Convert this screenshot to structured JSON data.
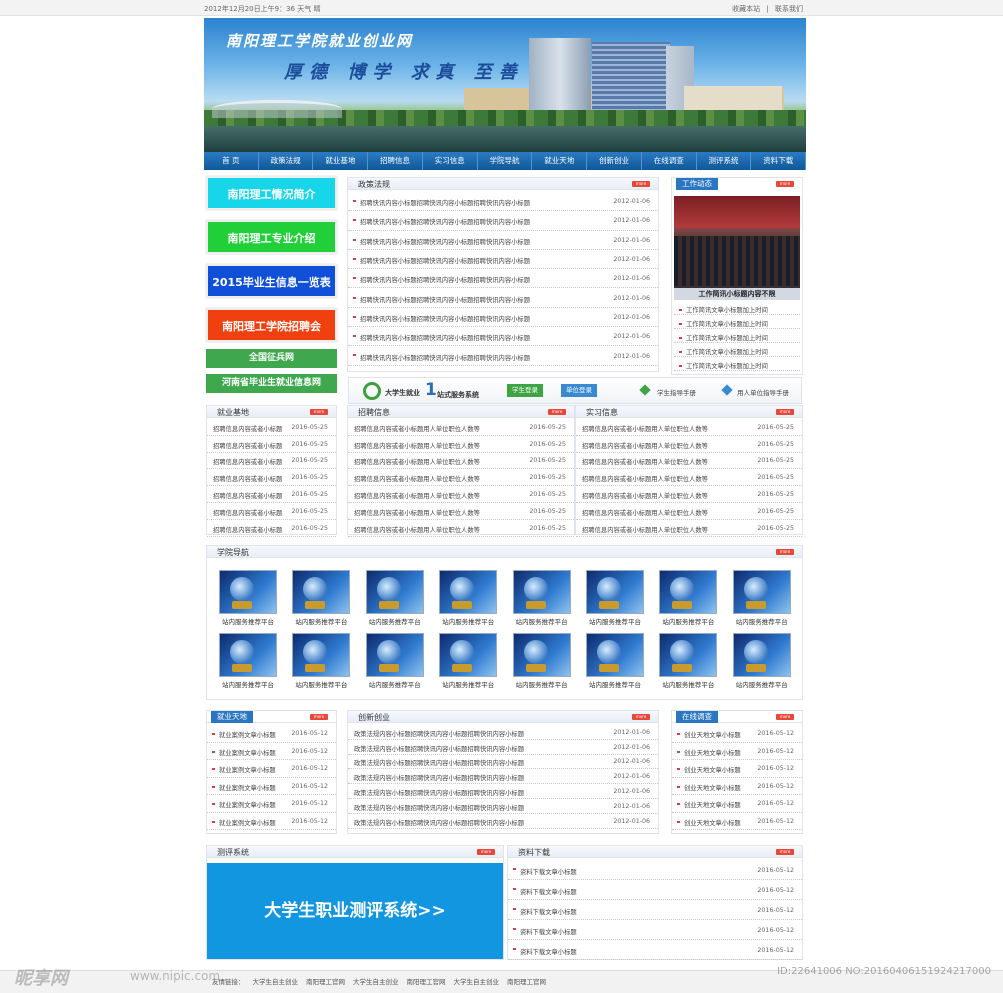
{
  "topbar": {
    "date_weather": "2012年12月20日上午9：36  天气  晴",
    "bookmark": "收藏本站",
    "separator": "|",
    "contact": "联系我们"
  },
  "banner": {
    "site_name": "南阳理工学院就业创业网",
    "motto": "厚德 博学 求真 至善"
  },
  "nav": [
    "首 页",
    "政策法规",
    "就业基地",
    "招聘信息",
    "实习信息",
    "学院导航",
    "就业天地",
    "创新创业",
    "在线调查",
    "测评系统",
    "资料下载"
  ],
  "left_links": [
    {
      "label": "南阳理工情况简介",
      "color": "#18d6ea"
    },
    {
      "label": "南阳理工专业介绍",
      "color": "#21d038"
    },
    {
      "label": "2015毕业生信息一览表",
      "color": "#1050d8"
    },
    {
      "label": "南阳理工学院招聘会",
      "color": "#f04010"
    }
  ],
  "left_small_links": [
    "全国征兵网",
    "河南省毕业生就业信息网"
  ],
  "more_label": "more",
  "policy": {
    "title": "政策法规",
    "items": [
      {
        "text": "招聘快讯内容小标题招聘快讯内容小标题招聘快讯内容小标题",
        "date": "2012-01-06"
      },
      {
        "text": "招聘快讯内容小标题招聘快讯内容小标题招聘快讯内容小标题",
        "date": "2012-01-06"
      },
      {
        "text": "招聘快讯内容小标题招聘快讯内容小标题招聘快讯内容小标题",
        "date": "2012-01-06"
      },
      {
        "text": "招聘快讯内容小标题招聘快讯内容小标题招聘快讯内容小标题",
        "date": "2012-01-06"
      },
      {
        "text": "招聘快讯内容小标题招聘快讯内容小标题招聘快讯内容小标题",
        "date": "2012-01-06"
      },
      {
        "text": "招聘快讯内容小标题招聘快讯内容小标题招聘快讯内容小标题",
        "date": "2012-01-06"
      },
      {
        "text": "招聘快讯内容小标题招聘快讯内容小标题招聘快讯内容小标题",
        "date": "2012-01-06"
      },
      {
        "text": "招聘快讯内容小标题招聘快讯内容小标题招聘快讯内容小标题",
        "date": "2012-01-06"
      },
      {
        "text": "招聘快讯内容小标题招聘快讯内容小标题招聘快讯内容小标题",
        "date": "2012-01-06"
      }
    ]
  },
  "work": {
    "title": "工作动态",
    "caption": "工作简讯小标题内容不限",
    "items": [
      "工作简讯文章小标题加上时间",
      "工作简讯文章小标题加上时间",
      "工作简讯文章小标题加上时间",
      "工作简讯文章小标题加上时间",
      "工作简讯文章小标题加上时间"
    ]
  },
  "system": {
    "logo": "大学生就业",
    "logo_num": "1",
    "logo_tail": "站式服务系统",
    "student_login": "学生登录",
    "unit_login": "单位登录",
    "student_manual": "学生指导手册",
    "unit_manual": "用人单位指导手册"
  },
  "base": {
    "title": "就业基地",
    "items": [
      {
        "text": "招聘信息内容或者小标题",
        "date": "2016-05-25"
      },
      {
        "text": "招聘信息内容或者小标题",
        "date": "2016-05-25"
      },
      {
        "text": "招聘信息内容或者小标题",
        "date": "2016-05-25"
      },
      {
        "text": "招聘信息内容或者小标题",
        "date": "2016-05-25"
      },
      {
        "text": "招聘信息内容或者小标题",
        "date": "2016-05-25"
      },
      {
        "text": "招聘信息内容或者小标题",
        "date": "2016-05-25"
      },
      {
        "text": "招聘信息内容或者小标题",
        "date": "2016-05-25"
      }
    ]
  },
  "recruit": {
    "title": "招聘信息",
    "items": [
      {
        "text": "招聘信息内容或者小标题用人单位职位人数等",
        "date": "2016-05-25"
      },
      {
        "text": "招聘信息内容或者小标题用人单位职位人数等",
        "date": "2016-05-25"
      },
      {
        "text": "招聘信息内容或者小标题用人单位职位人数等",
        "date": "2016-05-25"
      },
      {
        "text": "招聘信息内容或者小标题用人单位职位人数等",
        "date": "2016-05-25"
      },
      {
        "text": "招聘信息内容或者小标题用人单位职位人数等",
        "date": "2016-05-25"
      },
      {
        "text": "招聘信息内容或者小标题用人单位职位人数等",
        "date": "2016-05-25"
      },
      {
        "text": "招聘信息内容或者小标题用人单位职位人数等",
        "date": "2016-05-25"
      }
    ]
  },
  "intern": {
    "title": "实习信息",
    "items": [
      {
        "text": "招聘信息内容或者小标题用人单位职位人数等",
        "date": "2016-05-25"
      },
      {
        "text": "招聘信息内容或者小标题用人单位职位人数等",
        "date": "2016-05-25"
      },
      {
        "text": "招聘信息内容或者小标题用人单位职位人数等",
        "date": "2016-05-25"
      },
      {
        "text": "招聘信息内容或者小标题用人单位职位人数等",
        "date": "2016-05-25"
      },
      {
        "text": "招聘信息内容或者小标题用人单位职位人数等",
        "date": "2016-05-25"
      },
      {
        "text": "招聘信息内容或者小标题用人单位职位人数等",
        "date": "2016-05-25"
      },
      {
        "text": "招聘信息内容或者小标题用人单位职位人数等",
        "date": "2016-05-25"
      }
    ]
  },
  "college_nav": {
    "title": "学院导航",
    "tile_label": "站内服务推荐平台"
  },
  "career": {
    "title": "就业天地",
    "items": [
      {
        "text": "就业案例文章小标题",
        "date": "2016-05-12"
      },
      {
        "text": "就业案例文章小标题",
        "date": "2016-05-12"
      },
      {
        "text": "就业案例文章小标题",
        "date": "2016-05-12"
      },
      {
        "text": "就业案例文章小标题",
        "date": "2016-05-12"
      },
      {
        "text": "就业案例文章小标题",
        "date": "2016-05-12"
      },
      {
        "text": "就业案例文章小标题",
        "date": "2016-05-12"
      }
    ]
  },
  "innovation": {
    "title": "创新创业",
    "items": [
      {
        "text": "政策法规内容小标题招聘快讯内容小标题招聘快讯内容小标题",
        "date": "2012-01-06"
      },
      {
        "text": "政策法规内容小标题招聘快讯内容小标题招聘快讯内容小标题",
        "date": "2012-01-06"
      },
      {
        "text": "政策法规内容小标题招聘快讯内容小标题招聘快讯内容小标题",
        "date": "2012-01-06"
      },
      {
        "text": "政策法规内容小标题招聘快讯内容小标题招聘快讯内容小标题",
        "date": "2012-01-06"
      },
      {
        "text": "政策法规内容小标题招聘快讯内容小标题招聘快讯内容小标题",
        "date": "2012-01-06"
      },
      {
        "text": "政策法规内容小标题招聘快讯内容小标题招聘快讯内容小标题",
        "date": "2012-01-06"
      },
      {
        "text": "政策法规内容小标题招聘快讯内容小标题招聘快讯内容小标题",
        "date": "2012-01-06"
      }
    ]
  },
  "survey": {
    "title": "在线调查",
    "items": [
      {
        "text": "创业天地文章小标题",
        "date": "2016-05-12"
      },
      {
        "text": "创业天地文章小标题",
        "date": "2016-05-12"
      },
      {
        "text": "创业天地文章小标题",
        "date": "2016-05-12"
      },
      {
        "text": "创业天地文章小标题",
        "date": "2016-05-12"
      },
      {
        "text": "创业天地文章小标题",
        "date": "2016-05-12"
      },
      {
        "text": "创业天地文章小标题",
        "date": "2016-05-12"
      }
    ]
  },
  "assessment": {
    "title": "测评系统",
    "banner": "大学生职业测评系统>>",
    "color": "#1396e0"
  },
  "downloads": {
    "title": "资料下载",
    "items": [
      {
        "text": "资料下载文章小标题",
        "date": "2016-05-12"
      },
      {
        "text": "资料下载文章小标题",
        "date": "2016-05-12"
      },
      {
        "text": "资料下载文章小标题",
        "date": "2016-05-12"
      },
      {
        "text": "资料下载文章小标题",
        "date": "2016-05-12"
      },
      {
        "text": "资料下载文章小标题",
        "date": "2016-05-12"
      }
    ]
  },
  "footer": {
    "label": "友情链接：",
    "links": [
      "大学生自主创业",
      "南阳理工官网",
      "大学生自主创业",
      "南阳理工官网",
      "大学生自主创业",
      "南阳理工官网"
    ]
  },
  "watermark": {
    "logo": "昵享网",
    "url": "www.nipic.com",
    "id": "ID:22641006 NO:20160406151924217000"
  }
}
